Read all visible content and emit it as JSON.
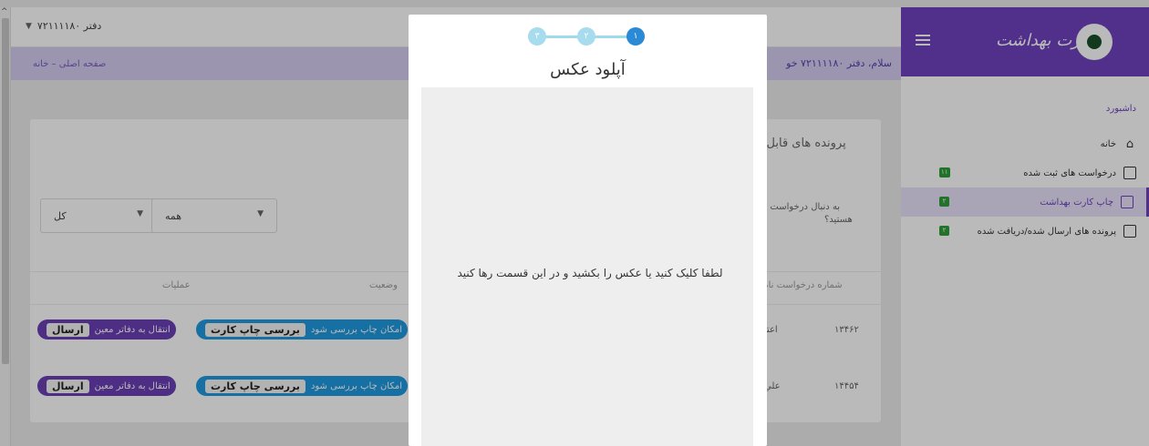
{
  "topbar": {
    "office": "دفتر ۷۲۱۱۱۱۸۰"
  },
  "breadcrumb": {
    "text": "صفحه اصلی – خانه"
  },
  "greeting": "سلام، دفتر ۷۲۱۱۱۱۸۰ خو",
  "sidebar": {
    "logo": "کارت بهداشت",
    "section_title": "داشبورد",
    "items": [
      {
        "label": "خانه",
        "badge": ""
      },
      {
        "label": "درخواست های ثبت شده",
        "badge": "۱۱"
      },
      {
        "label": "چاپ کارت بهداشت",
        "badge": "۲"
      },
      {
        "label": "پرونده های ارسال شده/دریافت شده",
        "badge": "۲"
      }
    ]
  },
  "card": {
    "title": "پرونده های قابل چ",
    "search_hint_line1": "به دنبال درخواست خا",
    "search_hint_line2": "هستید؟",
    "filter_all": "همه",
    "filter_kol": "کل",
    "headers": {
      "operations": "عملیات",
      "status": "وضعیت",
      "request_no": "#شماره درخواست نام"
    },
    "rows": [
      {
        "number": "۱۳۴۶۲",
        "name_fragment": "اعتـ",
        "status_text": "امکان چاپ بررسی شود",
        "status_tag": "بررسی چاپ کارت",
        "op_text": "انتقال به دفاتر معین",
        "op_tag": "ارسال"
      },
      {
        "number": "۱۴۴۵۴",
        "name_fragment": "علي",
        "status_text": "امکان چاپ بررسی شود",
        "status_tag": "بررسی چاپ کارت",
        "op_text": "انتقال به دفاتر معین",
        "op_tag": "ارسال"
      }
    ]
  },
  "modal": {
    "title": "آپلود عکس",
    "steps": [
      "۱",
      "۲",
      "۳"
    ],
    "active_step": "۱",
    "dropzone_text": "لطفا کلیک کنید یا عکس را بکشید و در این قسمت رها کنید"
  },
  "colors": {
    "brand_purple": "#6f42c1",
    "step_active": "#2b8ad6",
    "badge_green": "#2e9e3a"
  }
}
